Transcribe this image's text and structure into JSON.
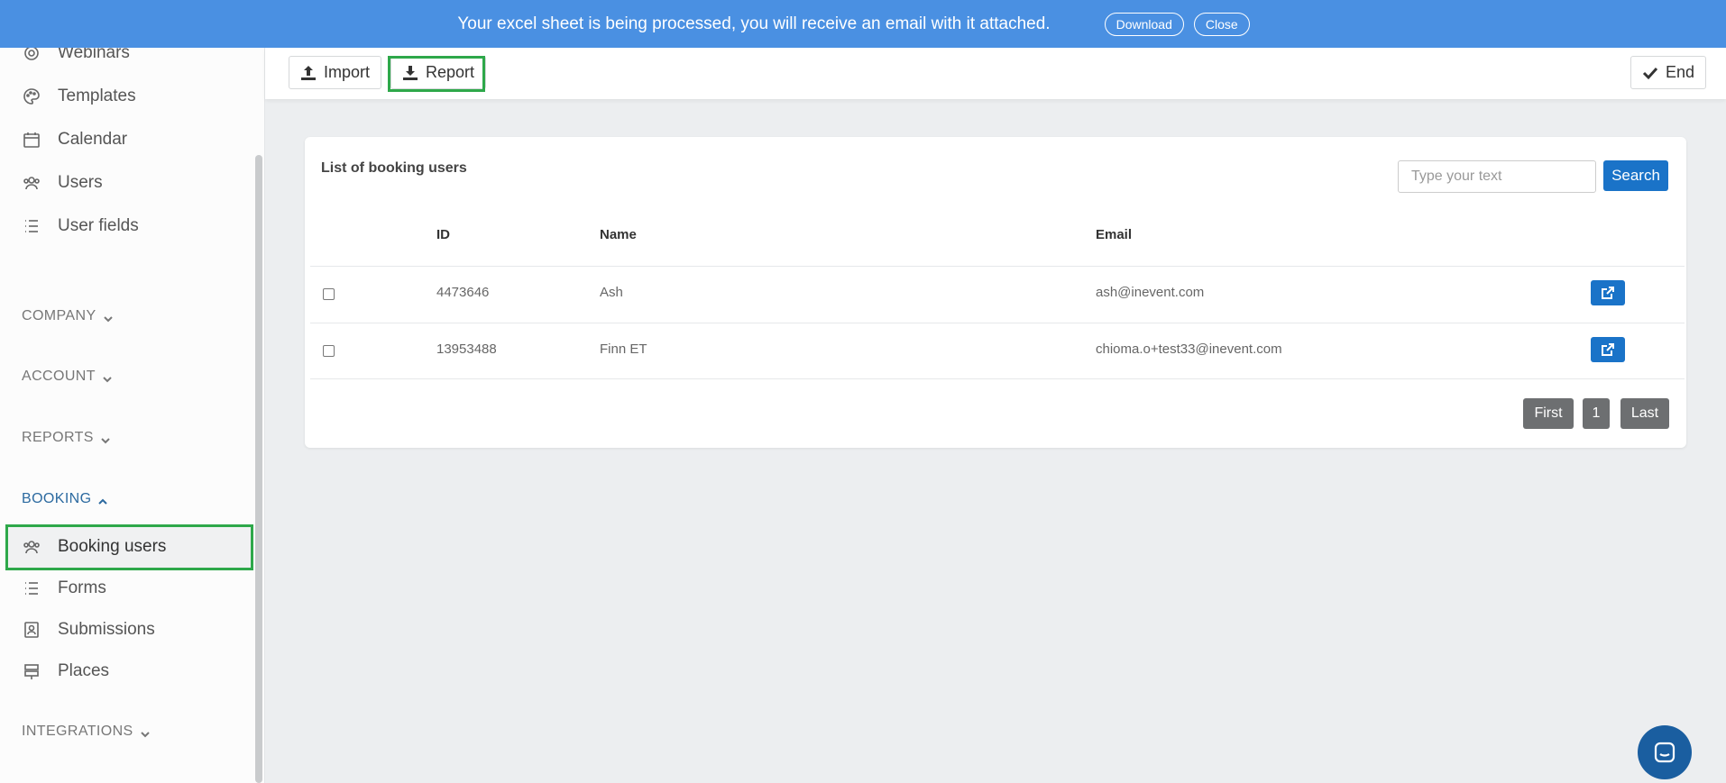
{
  "banner": {
    "message": "Your excel sheet is being processed, you will receive an email with it attached.",
    "download_label": "Download",
    "close_label": "Close"
  },
  "sidebar": {
    "items_top": [
      {
        "label": "Webinars",
        "icon": "webinar-icon"
      },
      {
        "label": "Templates",
        "icon": "palette-icon"
      },
      {
        "label": "Calendar",
        "icon": "calendar-icon"
      },
      {
        "label": "Users",
        "icon": "users-icon"
      },
      {
        "label": "User fields",
        "icon": "list-icon"
      }
    ],
    "sections": [
      {
        "label": "COMPANY",
        "expanded": false
      },
      {
        "label": "ACCOUNT",
        "expanded": false
      },
      {
        "label": "REPORTS",
        "expanded": false
      },
      {
        "label": "BOOKING",
        "expanded": true
      },
      {
        "label": "INTEGRATIONS",
        "expanded": false
      }
    ],
    "booking_items": [
      {
        "label": "Booking users",
        "icon": "users-icon",
        "active": true
      },
      {
        "label": "Forms",
        "icon": "list-icon"
      },
      {
        "label": "Submissions",
        "icon": "contact-card-icon"
      },
      {
        "label": "Places",
        "icon": "signpost-icon"
      }
    ]
  },
  "toolbar": {
    "import_label": "Import",
    "report_label": "Report",
    "end_label": "End"
  },
  "card": {
    "title": "List of booking users",
    "search": {
      "placeholder": "Type your text",
      "button_label": "Search"
    },
    "columns": [
      "ID",
      "Name",
      "Email"
    ],
    "rows": [
      {
        "id": "4473646",
        "name": "Ash",
        "email": "ash@inevent.com"
      },
      {
        "id": "13953488",
        "name": "Finn ET",
        "email": "chioma.o+test33@inevent.com"
      }
    ],
    "pagination": {
      "first": "First",
      "page": "1",
      "last": "Last"
    }
  },
  "colors": {
    "banner": "#4a90e2",
    "primary": "#1a73c8",
    "highlight": "#2ea84a",
    "active_section": "#2c6aa0"
  }
}
